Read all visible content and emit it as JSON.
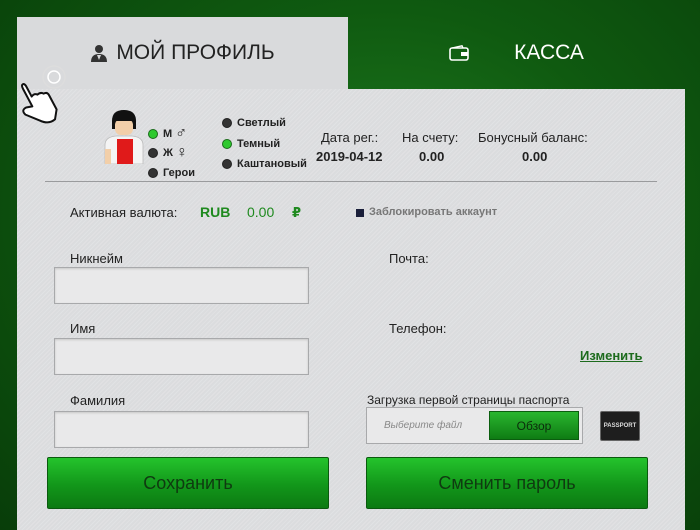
{
  "tabs": {
    "profile_label": "МОЙ ПРОФИЛЬ",
    "kassa_label": "КАССА"
  },
  "gender": {
    "male_label": "М",
    "female_label": "Ж",
    "hero_label": "Герои",
    "male_symbol": "♂",
    "female_symbol": "♀",
    "selected": "М"
  },
  "hair": {
    "light_label": "Светлый",
    "dark_label": "Темный",
    "chestnut_label": "Каштановый",
    "selected": "Темный"
  },
  "stats": {
    "reg_date_label": "Дата рег.:",
    "reg_date_value": "2019-04-12",
    "balance_label": "На счету:",
    "balance_value": "0.00",
    "bonus_label": "Бонусный баланс:",
    "bonus_value": "0.00"
  },
  "currency": {
    "label": "Активная валюта:",
    "code": "RUB",
    "amount": "0.00",
    "symbol": "₽"
  },
  "block_account_label": "Заблокировать аккаунт",
  "fields": {
    "nickname_label": "Никнейм",
    "name_label": "Имя",
    "surname_label": "Фамилия",
    "email_label": "Почта:",
    "phone_label": "Телефон:",
    "change_link": "Изменить"
  },
  "passport": {
    "label": "Загрузка первой страницы паспорта",
    "placeholder": "Выберите файл",
    "browse_label": "Обзор",
    "badge": "PASSPORT"
  },
  "buttons": {
    "save": "Сохранить",
    "change_password": "Сменить пароль"
  },
  "colors": {
    "accent_green": "#1f8a1f",
    "button_green": "#12961a",
    "background_green": "#0f5a10",
    "panel_gray": "#dbdcde"
  }
}
